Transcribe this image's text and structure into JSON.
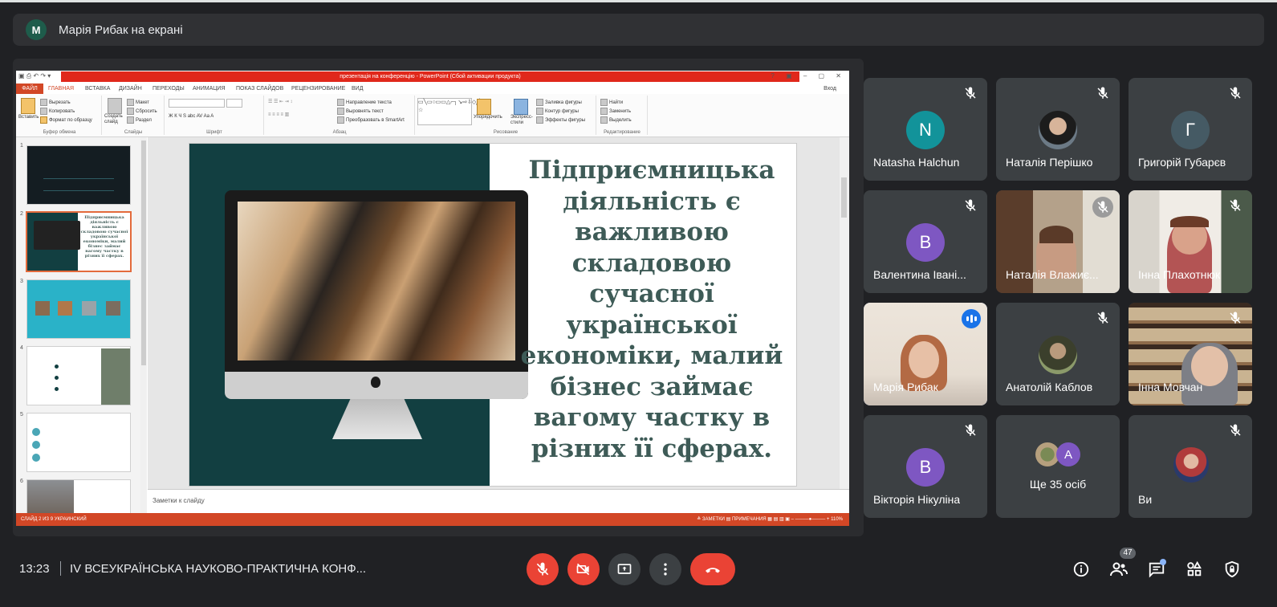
{
  "banner": {
    "avatar_letter": "M",
    "text": "Марія Рибак на екрані"
  },
  "ppt": {
    "title_bar": "презентація на конференцію - PowerPoint (Сбой активации продукта)",
    "title_controls": "? ▣ – ▢ ✕",
    "tabs": [
      "ФАЙЛ",
      "ГЛАВНАЯ",
      "ВСТАВКА",
      "ДИЗАЙН",
      "ПЕРЕХОДЫ",
      "АНИМАЦИЯ",
      "ПОКАЗ СЛАЙДОВ",
      "РЕЦЕНЗИРОВАНИЕ",
      "ВИД"
    ],
    "login": "Вход",
    "ribbon": {
      "clipboard": {
        "paste": "Вставить",
        "cut": "Вырезать",
        "copy": "Копировать",
        "format": "Формат по образцу",
        "caption": "Буфер обмена"
      },
      "slides": {
        "new": "Создать слайд",
        "layout": "Макет",
        "reset": "Сбросить",
        "section": "Раздел",
        "caption": "Слайды"
      },
      "font": {
        "caption": "Шрифт",
        "controls": "Ж К Ч S abc AV Aa A"
      },
      "paragraph": {
        "direction": "Направление текста",
        "align": "Выровнять текст",
        "smartart": "Преобразовать в SmartArt",
        "caption": "Абзац"
      },
      "drawing": {
        "arrange": "Упорядочить",
        "styles": "Экспресс-стили",
        "fill": "Заливка фигуры",
        "outline": "Контур фигуры",
        "effects": "Эффекты фигуры",
        "caption": "Рисование"
      },
      "editing": {
        "find": "Найти",
        "replace": "Заменить",
        "select": "Выделить",
        "caption": "Редактирование"
      }
    },
    "thumbnails": [
      "1",
      "2",
      "3",
      "4",
      "5",
      "6"
    ],
    "thumb2_text": "Підприємницька діяльність є важливою складовою сучасної української економіки, малий бізнес займає вагому частку в різних її сферах.",
    "slide_heading": "Підприємницька діяльність є важливою складовою сучасної української економіки, малий бізнес займає вагому частку в різних її сферах.",
    "notes_placeholder": "Заметки к слайду",
    "status_left": "СЛАЙД 2 ИЗ 9     УКРАИНСКИЙ",
    "status_right": "≜ ЗАМЕТКИ   ▤ ПРИМЕЧАНИЯ   ▦ ▤ ▥ ▣   – ────●──── +  110%"
  },
  "participants": [
    {
      "name": "Natasha Halchun",
      "type": "letter",
      "letter": "N",
      "color": "#12939a"
    },
    {
      "name": "Наталія Перішко",
      "type": "photo"
    },
    {
      "name": "Григорій Губарєв",
      "type": "letter",
      "letter": "Г",
      "color": "#455a64"
    },
    {
      "name": "Валентина Івані...",
      "type": "letter",
      "letter": "В",
      "color": "#7e57c2"
    },
    {
      "name": "Наталія Влажиє...",
      "type": "video"
    },
    {
      "name": "Інна Плахотнюк",
      "type": "video"
    },
    {
      "name": "Марія Рибак",
      "type": "video",
      "speaking": true
    },
    {
      "name": "Анатолій Каблов",
      "type": "photo"
    },
    {
      "name": "Інна Мовчан",
      "type": "video"
    },
    {
      "name": "Вікторія Нікуліна",
      "type": "letter",
      "letter": "В",
      "color": "#7e57c2"
    },
    {
      "name": "Ще 35 осіб",
      "type": "group",
      "letter": "A",
      "color": "#7e57c2"
    },
    {
      "name": "Ви",
      "type": "photo"
    }
  ],
  "bottom": {
    "time": "13:23",
    "separator": "|",
    "meeting_title": "IV ВСЕУКРАЇНСЬКА НАУКОВО-ПРАКТИЧНА КОНФ...",
    "participant_count": "47"
  },
  "colors": {
    "accent": "#8ab4f8",
    "danger": "#ea4335",
    "tile": "#3c4043",
    "background": "#202124"
  }
}
